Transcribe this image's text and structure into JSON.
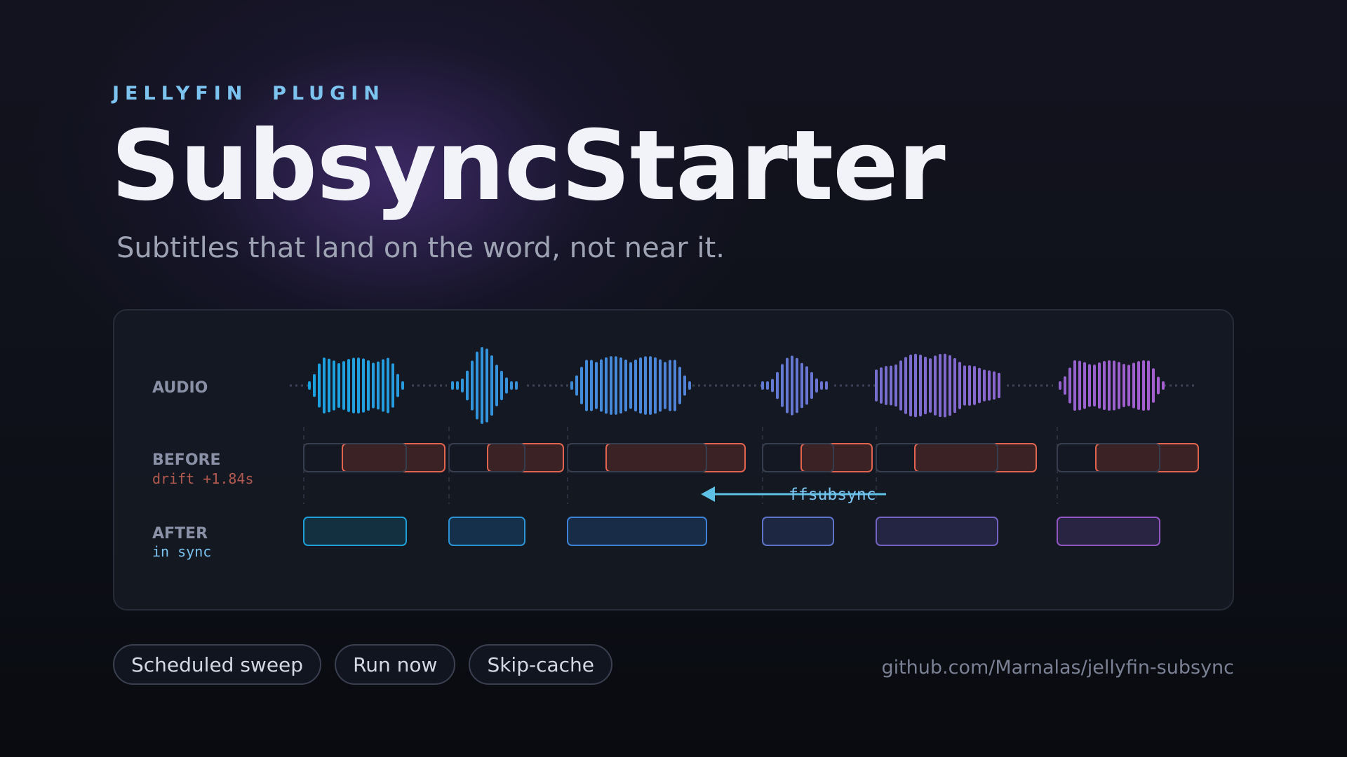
{
  "header": {
    "eyebrow": "JELLYFIN  PLUGIN",
    "title": "SubsyncStarter",
    "subtitle": "Subtitles that land on the word, not near it."
  },
  "timeline": {
    "rows": {
      "audio": {
        "label": "AUDIO"
      },
      "before": {
        "label": "BEFORE",
        "sublabel": "drift +1.84s"
      },
      "after": {
        "label": "AFTER",
        "sublabel": "in sync"
      }
    },
    "tool_label": "ffsubsync",
    "colors": {
      "audio_gradient": [
        "#1aa3e0",
        "#4b86d8",
        "#7b6ccd",
        "#a55dcf"
      ],
      "before_stroke": "#e0644f",
      "before_fill": "#3c2326",
      "after_gradient": [
        "#1aa3e0",
        "#a55dcf"
      ],
      "arrow": "#5ec0e5"
    }
  },
  "tags": [
    "Scheduled sweep",
    "Run now",
    "Skip-cache"
  ],
  "repo_link": "github.com/Marnalas/jellyfin-subsync"
}
